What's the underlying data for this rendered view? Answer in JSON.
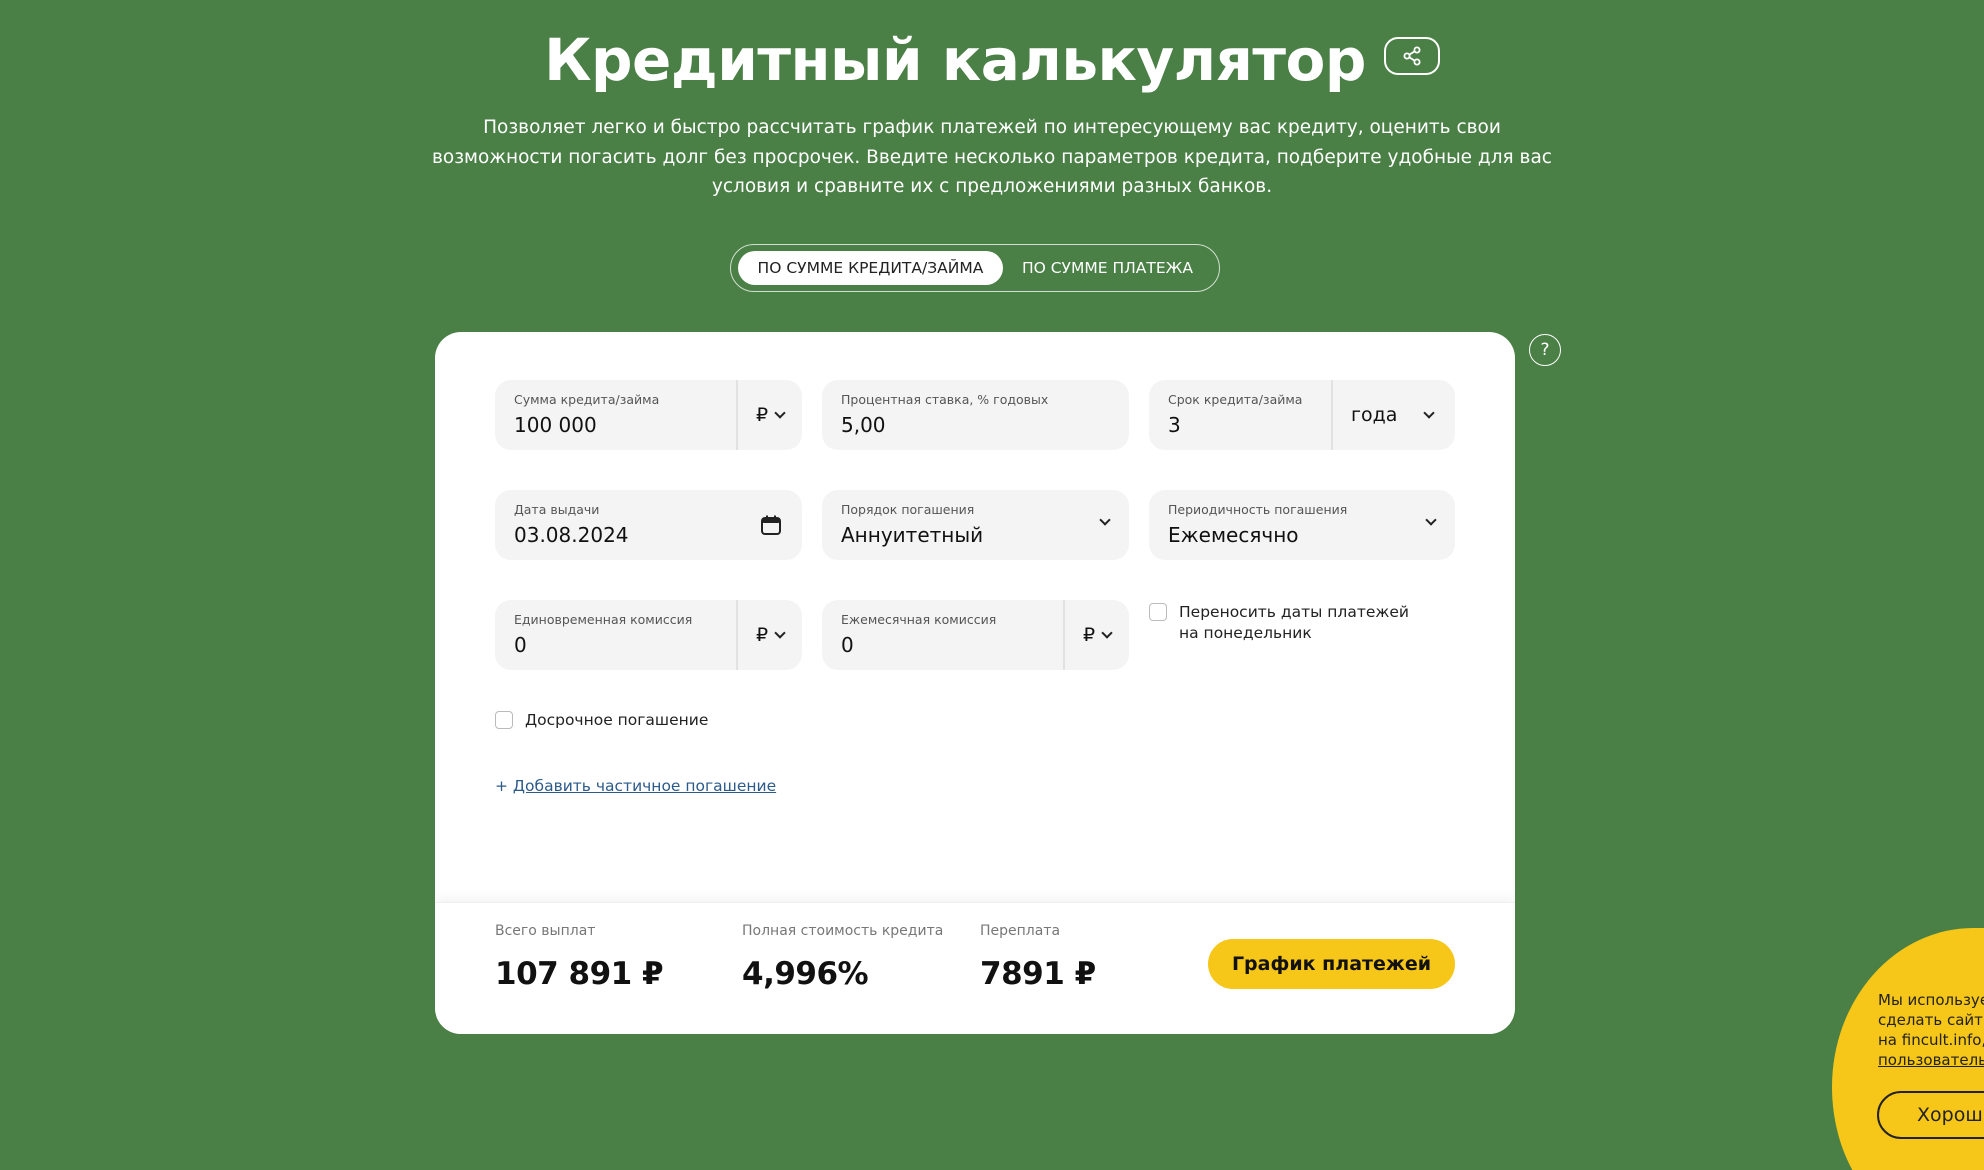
{
  "header": {
    "title": "Кредитный калькулятор",
    "share_icon": "share-icon",
    "subtitle": "Позволяет легко и быстро рассчитать график платежей по интересующему вас кредиту, оценить свои возможности погасить долг без просрочек. Введите несколько параметров кредита, подберите удобные для вас условия и сравните их с предложениями разных банков."
  },
  "mode_tabs": [
    {
      "label": "По сумме кредита/займа",
      "active": true
    },
    {
      "label": "По сумме платежа",
      "active": false
    }
  ],
  "help": {
    "label": "?"
  },
  "form": {
    "loan_amount": {
      "label": "Сумма кредита/займа",
      "value": "100 000",
      "currency": "₽"
    },
    "interest_rate": {
      "label": "Процентная ставка, % годовых",
      "value": "5,00"
    },
    "term": {
      "label": "Срок кредита/займа",
      "value": "3",
      "unit": "года"
    },
    "issue_date": {
      "label": "Дата выдачи",
      "value": "03.08.2024"
    },
    "repayment_order": {
      "label": "Порядок погашения",
      "value": "Аннуитетный"
    },
    "repayment_frequency": {
      "label": "Периодичность погашения",
      "value": "Ежемесячно"
    },
    "one_time_fee": {
      "label": "Единовременная комиссия",
      "value": "0",
      "currency": "₽"
    },
    "monthly_fee": {
      "label": "Ежемесячная комиссия",
      "value": "0",
      "currency": "₽"
    },
    "move_to_monday": {
      "label_line1": "Переносить даты платежей",
      "label_line2": "на понедельник",
      "checked": false
    },
    "early_repayment": {
      "label": "Досрочное погашение",
      "checked": false
    },
    "add_partial": {
      "prefix": "+ ",
      "label": "Добавить частичное погашение"
    }
  },
  "summary": {
    "total_payments": {
      "label": "Всего выплат",
      "value": "107 891 ₽"
    },
    "full_cost": {
      "label": "Полная стоимость кредита",
      "value": "4,996%"
    },
    "overpayment": {
      "label": "Переплата",
      "value": "7891 ₽"
    },
    "schedule_button": "График платежей"
  },
  "cookie": {
    "line1": "Мы используе",
    "line2": "сделать сайт л",
    "line3": "на fincult.info, ",
    "line4": "пользовательс",
    "button": "Хорош"
  },
  "colors": {
    "background": "#4a8046",
    "accent": "#f6c619",
    "card": "#ffffff",
    "field": "#f4f4f4"
  }
}
